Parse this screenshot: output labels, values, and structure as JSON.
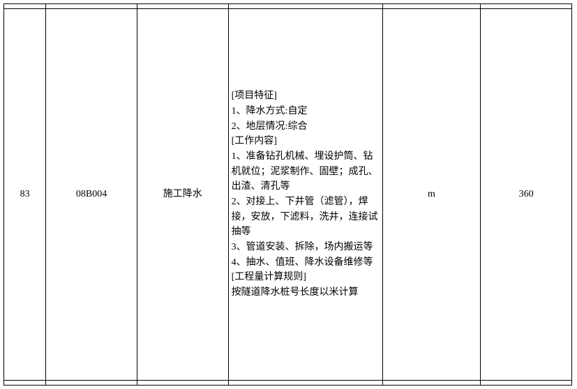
{
  "row": {
    "index": "83",
    "code": "08B004",
    "name": "施工降水",
    "description": "[项目特征]\n1、降水方式:自定\n2、地层情况:综合\n[工作内容]\n1、准备钻孔机械、埋设护筒、钻机就位；泥浆制作、固壁；成孔、出渣、清孔等\n2、对接上、下井管（滤管），焊接，安放，下滤料，洗井，连接试抽等\n3、管道安装、拆除，场内搬运等\n4、抽水、值班、降水设备维修等\n[工程量计算规则]\n按隧道降水桩号长度以米计算",
    "unit": "m",
    "qty": "360"
  }
}
